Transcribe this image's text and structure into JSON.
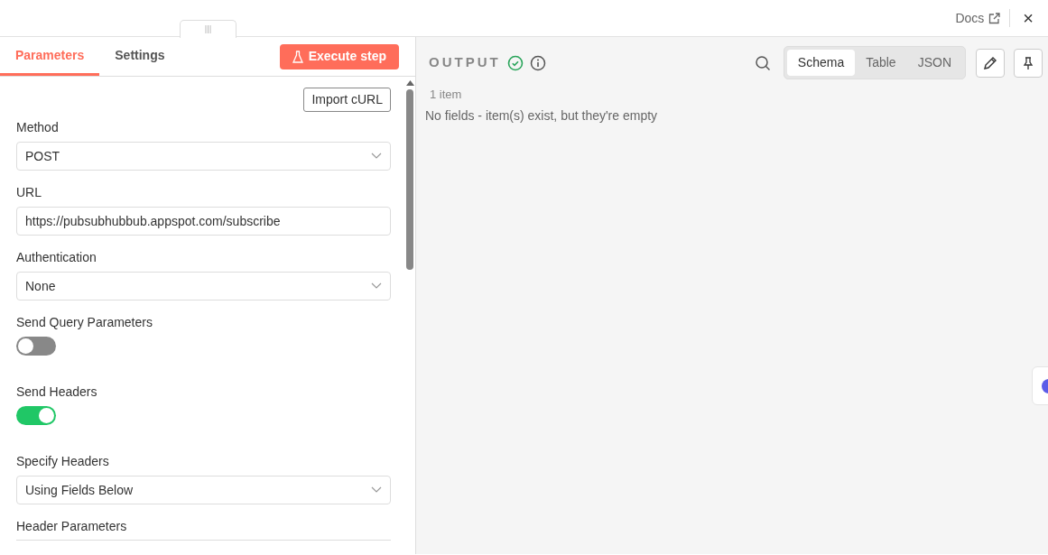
{
  "header": {
    "docs_link": "Docs",
    "close": "×"
  },
  "tabs": [
    {
      "label": "Parameters",
      "selected": true
    },
    {
      "label": "Settings",
      "selected": false
    }
  ],
  "execute_button": "Execute step",
  "import_button": "Import cURL",
  "fields": [
    {
      "kind": "select",
      "label": "Method",
      "value": "POST"
    },
    {
      "kind": "input",
      "label": "URL",
      "value": "https://pubsubhubbub.appspot.com/subscribe"
    },
    {
      "kind": "select",
      "label": "Authentication",
      "value": "None"
    },
    {
      "kind": "toggle",
      "label": "Send Query Parameters",
      "on": false
    },
    {
      "kind": "toggle",
      "label": "Send Headers",
      "on": true
    },
    {
      "kind": "select",
      "label": "Specify Headers",
      "value": "Using Fields Below"
    },
    {
      "kind": "section",
      "label": "Header Parameters"
    }
  ],
  "output": {
    "title": "OUTPUT",
    "views": [
      {
        "label": "Schema",
        "selected": true
      },
      {
        "label": "Table",
        "selected": false
      },
      {
        "label": "JSON",
        "selected": false
      }
    ],
    "count": "1 item",
    "message": "No fields - item(s) exist, but they're empty"
  }
}
